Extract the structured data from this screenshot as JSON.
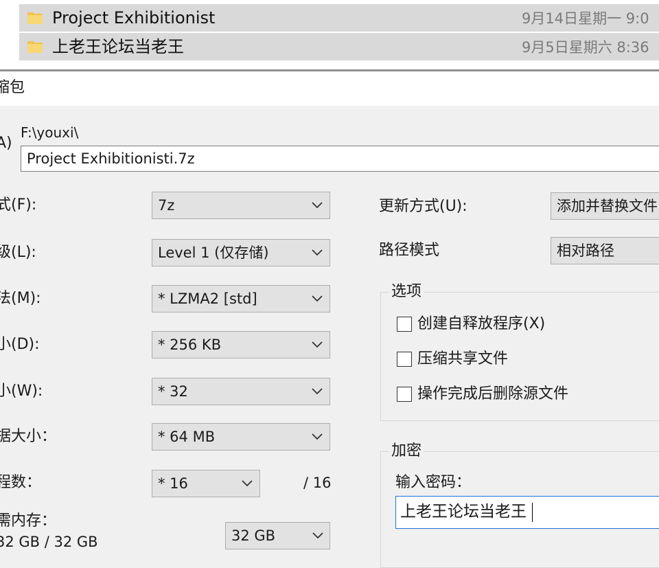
{
  "explorer": {
    "files": [
      {
        "name": "Project Exhibitionist",
        "date": "9月14日星期一 9:0"
      },
      {
        "name": "上老王论坛当老王",
        "date": "9月5日星期六 8:36"
      }
    ]
  },
  "dialog": {
    "title": "缩包",
    "archive_label": "A)",
    "path": "F:\\youxi\\",
    "archive_name": "Project Exhibitionisti.7z",
    "left_fields": [
      {
        "label": "式(F):",
        "value": "7z"
      },
      {
        "label": "级(L):",
        "value": "Level 1 (仅存储)"
      },
      {
        "label": "法(M):",
        "value": "* LZMA2 [std]"
      },
      {
        "label": "小(D):",
        "value": "* 256 KB"
      },
      {
        "label": "小(W):",
        "value": "* 32"
      },
      {
        "label": "据大小：",
        "value": "* 64 MB"
      },
      {
        "label": "程数：",
        "value": "* 16"
      }
    ],
    "threads_total": "/ 16",
    "memory_label": "需内存：",
    "memory_usage": "32 GB / 32 GB",
    "memory_value": "32 GB",
    "update_mode_label": "更新方式(U):",
    "update_mode_value": "添加并替换文件",
    "path_mode_label": "路径模式",
    "path_mode_value": "相对路径",
    "options_title": "选项",
    "options": [
      {
        "label": "创建自释放程序(X)",
        "checked": false
      },
      {
        "label": "压缩共享文件",
        "checked": false
      },
      {
        "label": "操作完成后删除源文件",
        "checked": false
      }
    ],
    "encryption_title": "加密",
    "password_label": "输入密码：",
    "password_value": "上老王论坛当老王"
  }
}
